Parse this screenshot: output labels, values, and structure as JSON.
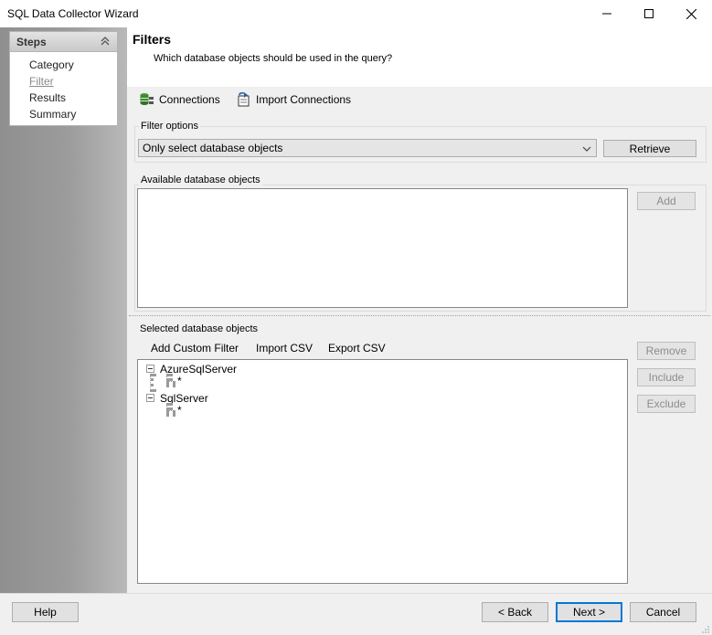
{
  "window": {
    "title": "SQL Data Collector Wizard"
  },
  "steps": {
    "title": "Steps",
    "items": [
      {
        "label": "Category",
        "current": false
      },
      {
        "label": "Filter",
        "current": true
      },
      {
        "label": "Results",
        "current": false
      },
      {
        "label": "Summary",
        "current": false
      }
    ]
  },
  "header": {
    "title": "Filters",
    "subtitle": "Which database objects should be used in the query?"
  },
  "toolbar": {
    "connections": "Connections",
    "import_connections": "Import Connections"
  },
  "filter_options": {
    "label": "Filter options",
    "selected": "Only select database objects",
    "retrieve": "Retrieve"
  },
  "available": {
    "label": "Available database objects",
    "add": "Add"
  },
  "selected": {
    "label": "Selected database objects",
    "add_custom_filter": "Add Custom Filter",
    "import_csv": "Import CSV",
    "export_csv": "Export CSV",
    "remove": "Remove",
    "include": "Include",
    "exclude": "Exclude",
    "tree": [
      {
        "label": "AzureSqlServer",
        "child": "*"
      },
      {
        "label": "SqlServer",
        "child": "*"
      }
    ]
  },
  "footer": {
    "help": "Help",
    "back": "< Back",
    "next": "Next >",
    "cancel": "Cancel"
  },
  "colors": {
    "focus_border": "#0078d7",
    "disabled_text": "#8d8d8d"
  }
}
